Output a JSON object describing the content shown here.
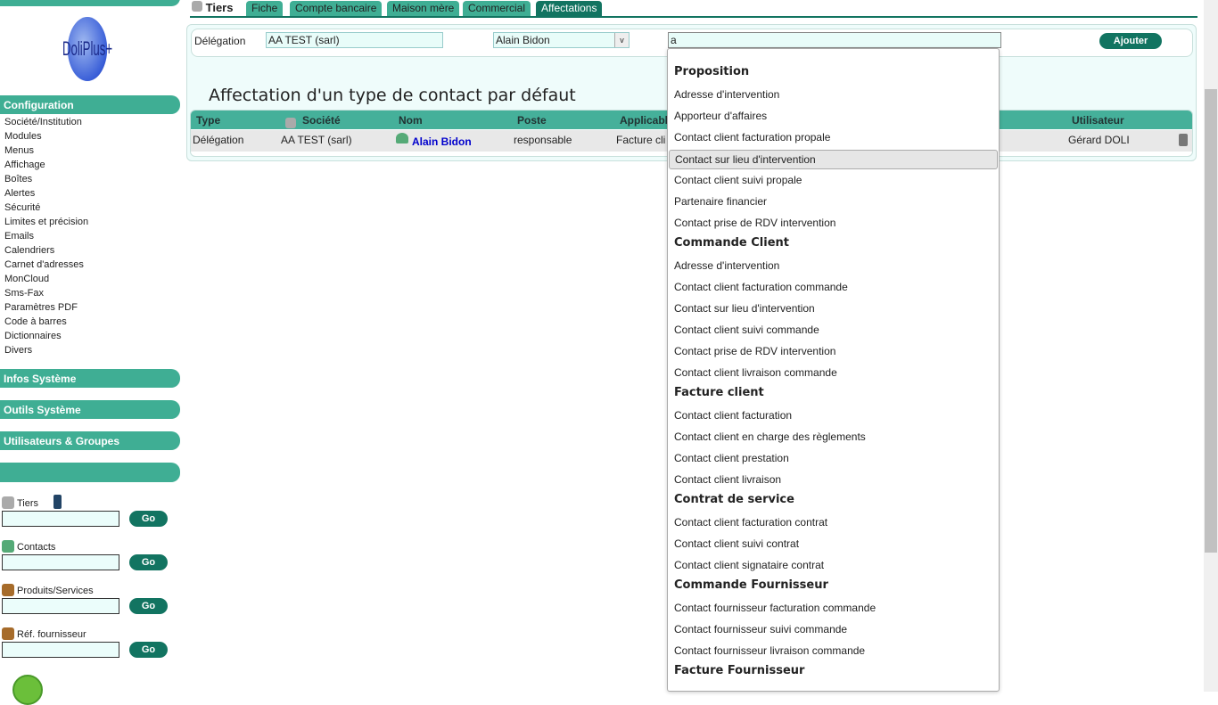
{
  "sidebar": {
    "logo_text": "DoliPlus+",
    "config_title": "Configuration",
    "config_items": [
      "Société/Institution",
      "Modules",
      "Menus",
      "Affichage",
      "Boîtes",
      "Alertes",
      "Sécurité",
      "Limites et précision",
      "Emails",
      "Calendriers",
      "Carnet d'adresses",
      "MonCloud",
      "Sms-Fax",
      "Paramètres PDF",
      "Code à barres",
      "Dictionnaires",
      "Divers"
    ],
    "infos": "Infos Système",
    "outils": "Outils Système",
    "users": "Utilisateurs & Groupes",
    "search": [
      {
        "label": "Tiers",
        "go": "Go"
      },
      {
        "label": "Contacts",
        "go": "Go"
      },
      {
        "label": "Produits/Services",
        "go": "Go"
      },
      {
        "label": "Réf. fournisseur",
        "go": "Go"
      }
    ]
  },
  "tabs": {
    "head": "Tiers",
    "items": [
      "Fiche",
      "Compte bancaire",
      "Maison mère",
      "Commercial",
      "Affectations"
    ],
    "active": "Affectations"
  },
  "form": {
    "label": "Délégation",
    "societe": "AA TEST (sarl)",
    "contact": "Alain Bidon",
    "type_input": "a",
    "add": "Ajouter"
  },
  "title": "Affectation d'un type de contact par défaut",
  "table": {
    "headers": [
      "Type",
      "Société",
      "Nom",
      "Poste",
      "Applicable",
      "Utilisateur"
    ],
    "row": {
      "type": "Délégation",
      "societe": "AA TEST (sarl)",
      "nom": "Alain Bidon",
      "poste": "responsable",
      "applicable": "Facture cli",
      "utilisateur": "Gérard DOLI"
    }
  },
  "dropdown": [
    {
      "group": "Proposition",
      "items": [
        "Adresse d'intervention",
        "Apporteur d'affaires",
        "Contact client facturation propale",
        "Contact sur lieu d'intervention",
        "Contact client suivi propale",
        "Partenaire financier",
        "Contact prise de RDV intervention"
      ]
    },
    {
      "group": "Commande Client",
      "items": [
        "Adresse d'intervention",
        "Contact client facturation commande",
        "Contact sur lieu d'intervention",
        "Contact client suivi commande",
        "Contact prise de RDV intervention",
        "Contact client livraison commande"
      ]
    },
    {
      "group": "Facture client",
      "items": [
        "Contact client facturation",
        "Contact client en charge des règlements",
        "Contact client prestation",
        "Contact client livraison"
      ]
    },
    {
      "group": "Contrat de service",
      "items": [
        "Contact client facturation contrat",
        "Contact client suivi contrat",
        "Contact client signataire contrat"
      ]
    },
    {
      "group": "Commande Fournisseur",
      "items": [
        "Contact fournisseur facturation commande",
        "Contact fournisseur suivi commande",
        "Contact fournisseur livraison commande"
      ]
    },
    {
      "group": "Facture Fournisseur",
      "items": []
    }
  ],
  "highlighted": "Contact sur lieu d'intervention"
}
